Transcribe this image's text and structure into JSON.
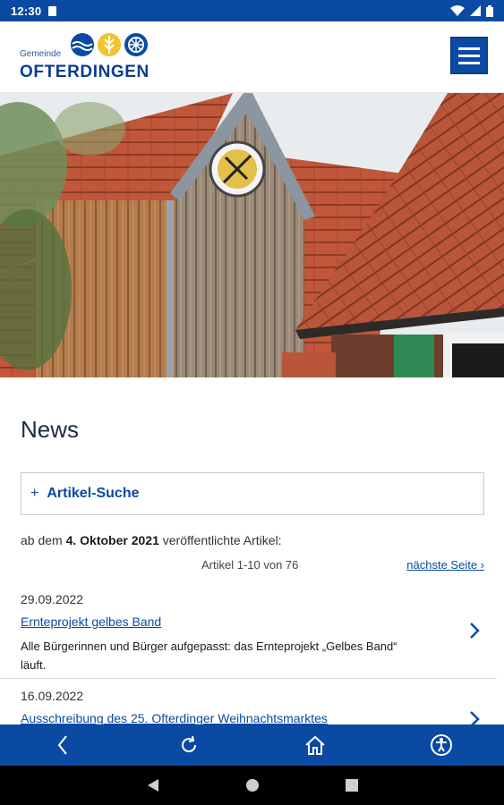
{
  "status_bar": {
    "time": "12:30"
  },
  "header": {
    "logo_prefix": "Gemeinde",
    "logo_name": "OFTERDINGEN",
    "menu_icon": "hamburger-menu-icon"
  },
  "hero": {
    "alt": "Holzturm mit Uhr und Ziegeldächern"
  },
  "news": {
    "title": "News",
    "search_label": "Artikel-Suche",
    "since_prefix": "ab dem",
    "since_date": "4. Oktober 2021",
    "since_suffix": "veröffentlichte Artikel:",
    "count_text": "Artikel 1-10 von 76",
    "next_link": "nächste Seite ›",
    "articles": [
      {
        "date": "29.09.2022",
        "title": "Ernteprojekt gelbes Band",
        "teaser": "Alle Bürgerinnen und Bürger aufgepasst: das Ernteprojekt „Gelbes Band“ läuft."
      },
      {
        "date": "16.09.2022",
        "title": "Ausschreibung des 25. Ofterdinger Weihnachtsmarktes",
        "teaser": ""
      }
    ]
  },
  "bottom_nav": [
    "back-icon",
    "refresh-icon",
    "home-icon",
    "accessibility-icon"
  ],
  "colors": {
    "primary": "#0a4aa3",
    "roof": "#c55a3a",
    "wood": "#b27a4a"
  }
}
